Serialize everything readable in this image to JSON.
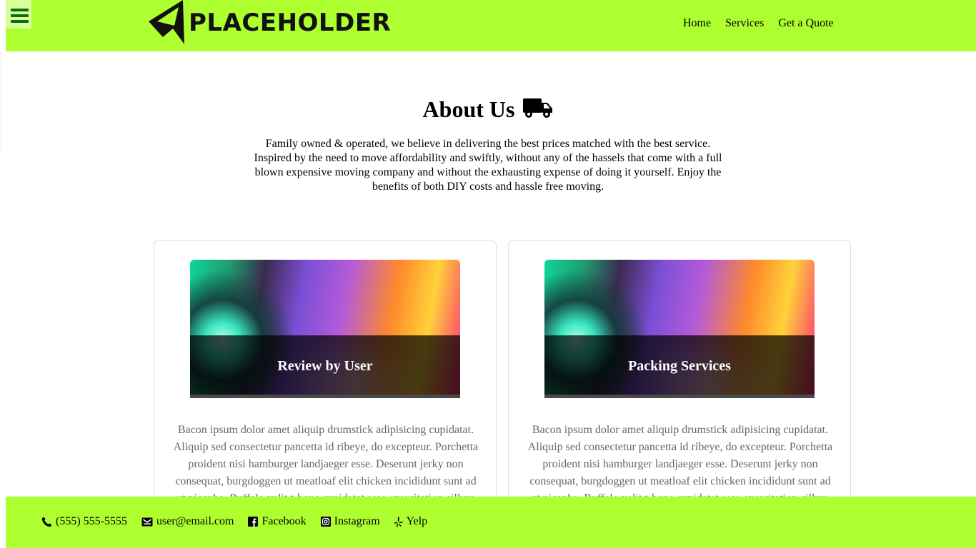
{
  "header": {
    "logo_text": "PLACEHOLDER",
    "nav": [
      {
        "label": "Home"
      },
      {
        "label": "Services"
      },
      {
        "label": "Get a Quote"
      }
    ],
    "accent_color": "#adff2f",
    "menu_icon": "hamburger-menu-icon"
  },
  "about": {
    "title": "About Us",
    "title_icon": "truck-icon",
    "text": "Family owned & operated, we believe in delivering the best prices matched with the best service. Inspired by the need to move affordability and swiftly, without any of the hassels that come with a full blown expensive moving company and without the exhausting expense of doing it yourself. Enjoy the benefits of both DIY costs and hassle free moving."
  },
  "cards": [
    {
      "caption": "Review by User",
      "text": "Bacon ipsum dolor amet aliquip drumstick adipisicing cupidatat. Aliquip sed consectetur pancetta id ribeye, do excepteur. Porchetta proident nisi hamburger landjaeger esse. Deserunt jerky non consequat, burgdoggen ut meatloaf elit chicken incididunt sunt ad ut picanha. Buffalo velit t-bone cupidatat esse exercitation cillum beef."
    },
    {
      "caption": "Packing Services",
      "text": "Bacon ipsum dolor amet aliquip drumstick adipisicing cupidatat. Aliquip sed consectetur pancetta id ribeye, do excepteur. Porchetta proident nisi hamburger landjaeger esse. Deserunt jerky non consequat, burgdoggen ut meatloaf elit chicken incididunt sunt ad ut picanha. Buffalo velit t-bone cupidatat esse exercitation cillum beef."
    }
  ],
  "footer": {
    "links": [
      {
        "label": "(555) 555-5555",
        "icon": "phone-icon"
      },
      {
        "label": "user@email.com",
        "icon": "envelope-icon"
      },
      {
        "label": "Facebook",
        "icon": "facebook-icon"
      },
      {
        "label": "Instagram",
        "icon": "instagram-icon"
      },
      {
        "label": "Yelp",
        "icon": "yelp-icon"
      }
    ]
  }
}
